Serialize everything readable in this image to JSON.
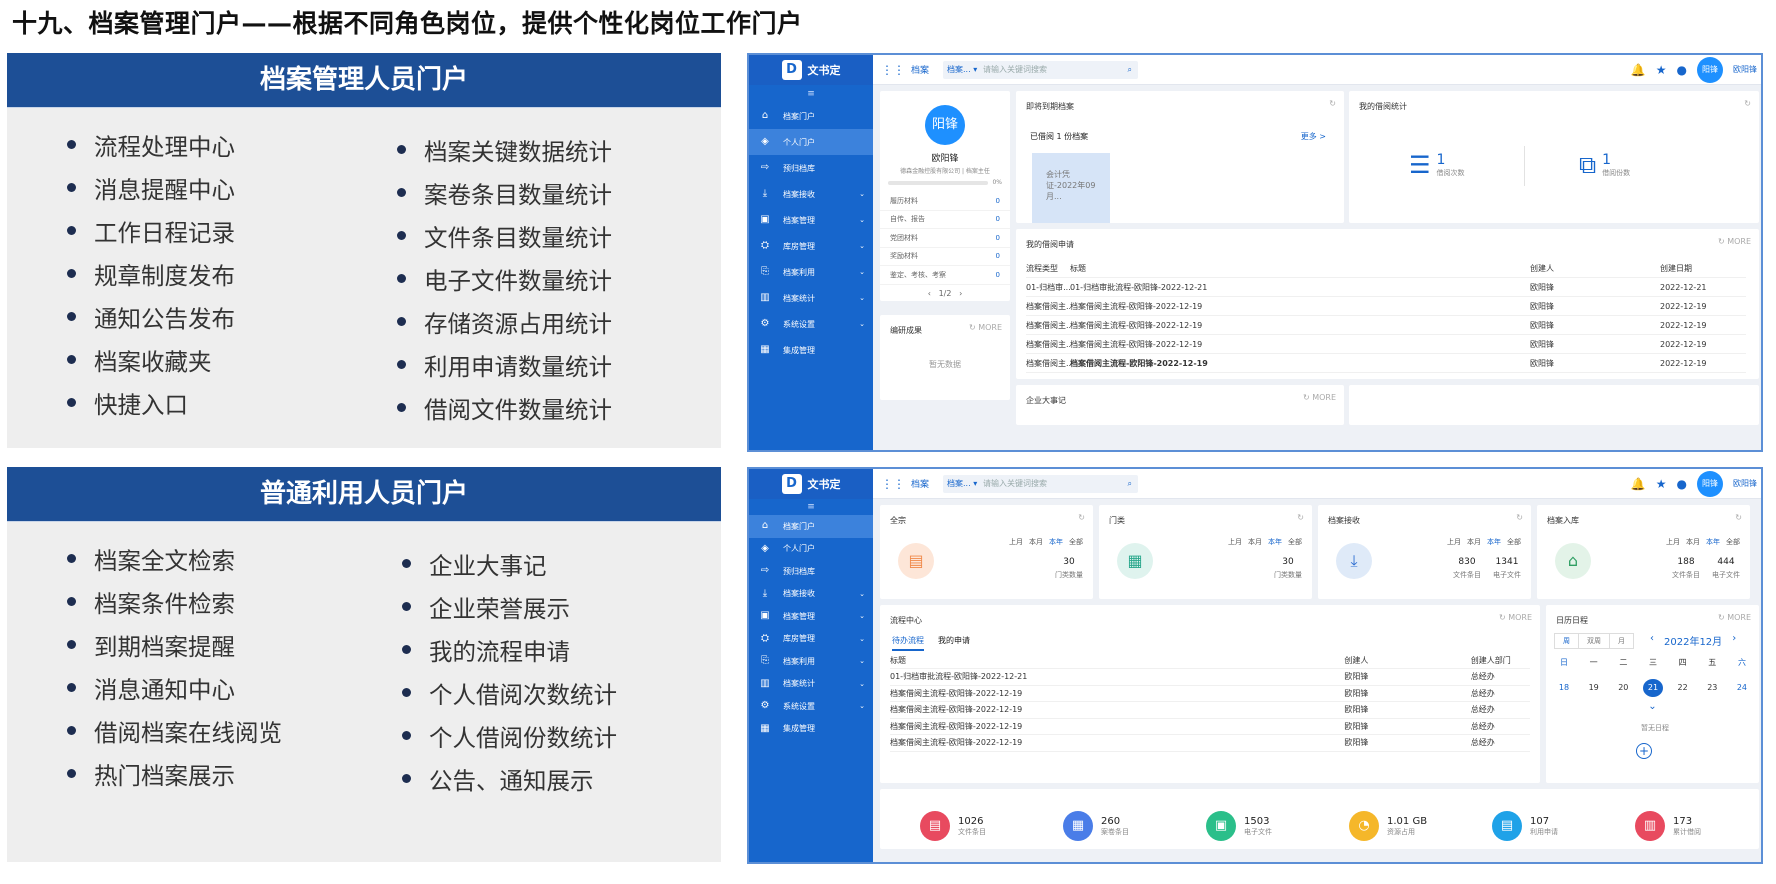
{
  "title": "十九、档案管理门户——根据不同角色岗位，提供个性化岗位工作门户",
  "panel1": {
    "heading": "档案管理人员门户",
    "left": [
      "流程处理中心",
      "消息提醒中心",
      "工作日程记录",
      "规章制度发布",
      "通知公告发布",
      "档案收藏夹",
      "快捷入口"
    ],
    "right": [
      "档案关键数据统计",
      "案卷条目数量统计",
      "文件条目数量统计",
      "电子文件数量统计",
      "存储资源占用统计",
      "利用申请数量统计",
      "借阅文件数量统计"
    ]
  },
  "panel2": {
    "heading": "普通利用人员门户",
    "left": [
      "档案全文检索",
      "档案条件检索",
      "到期档案提醒",
      "消息通知中心",
      "借阅档案在线阅览",
      "热门档案展示"
    ],
    "right": [
      "企业大事记",
      "企业荣誉展示",
      "我的流程申请",
      "个人借阅次数统计",
      "个人借阅份数统计",
      "公告、通知展示"
    ]
  },
  "app": {
    "logo": "文书定",
    "module": "档案",
    "search_select": "档案...",
    "search_placeholder": "请输入关键词搜索",
    "avatar": "阳锋",
    "user": "欧阳锋",
    "sidebar": [
      "档案门户",
      "个人门户",
      "预归档库",
      "档案接收",
      "档案管理",
      "库房管理",
      "档案利用",
      "档案统计",
      "系统设置",
      "集成管理"
    ]
  },
  "s1": {
    "profile": {
      "avatar": "阳锋",
      "name": "欧阳锋",
      "org": "德森金融控股有限公司 | 档案主任",
      "progress": "0%",
      "materials": [
        {
          "k": "履历材料",
          "v": "0"
        },
        {
          "k": "自传、报告",
          "v": "0"
        },
        {
          "k": "党团材料",
          "v": "0"
        },
        {
          "k": "奖励材料",
          "v": "0"
        },
        {
          "k": "鉴定、考核、考察",
          "v": "0"
        }
      ],
      "pager": "1/2"
    },
    "expire": {
      "title": "即将到期档案",
      "borrowed": "已借阅 1 份档案",
      "more": "更多 >",
      "doc": "会计凭证-2022年09月..."
    },
    "stats": {
      "title": "我的借阅统计",
      "times": "1",
      "times_label": "借阅次数",
      "copies": "1",
      "copies_label": "借阅份数"
    },
    "research": {
      "title": "编研成果",
      "more": "MORE",
      "empty": "暂无数据"
    },
    "apply": {
      "title": "我的借阅申请",
      "more": "MORE",
      "headers": [
        "流程类型",
        "标题",
        "创建人",
        "创建日期"
      ],
      "rows": [
        [
          "01-归档审...",
          "01-归档审批流程-欧阳锋-2022-12-21",
          "欧阳锋",
          "2022-12-21"
        ],
        [
          "档案借阅主...",
          "档案借阅主流程-欧阳锋-2022-12-19",
          "欧阳锋",
          "2022-12-19"
        ],
        [
          "档案借阅主...",
          "档案借阅主流程-欧阳锋-2022-12-19",
          "欧阳锋",
          "2022-12-19"
        ],
        [
          "档案借阅主...",
          "档案借阅主流程-欧阳锋-2022-12-19",
          "欧阳锋",
          "2022-12-19"
        ],
        [
          "档案借阅主...",
          "档案借阅主流程-欧阳锋-2022-12-19",
          "欧阳锋",
          "2022-12-19"
        ]
      ]
    },
    "events": {
      "title": "企业大事记",
      "more": "MORE"
    }
  },
  "s2": {
    "cards": [
      {
        "title": "全宗",
        "tabs": [
          "上月",
          "本月",
          "本年",
          "全部"
        ],
        "v1": "30",
        "l1": "门类数量"
      },
      {
        "title": "门类",
        "tabs": [
          "上月",
          "本月",
          "本年",
          "全部"
        ],
        "v1": "30",
        "l1": "门类数量"
      },
      {
        "title": "档案接收",
        "tabs": [
          "上月",
          "本月",
          "本年",
          "全部"
        ],
        "v1": "830",
        "l1": "文件条目",
        "v2": "1341",
        "l2": "电子文件"
      },
      {
        "title": "档案入库",
        "tabs": [
          "上月",
          "本月",
          "本年",
          "全部"
        ],
        "v1": "188",
        "l1": "文件条目",
        "v2": "444",
        "l2": "电子文件"
      }
    ],
    "flow": {
      "title": "流程中心",
      "more": "MORE",
      "tabs": [
        "待办流程",
        "我的申请"
      ],
      "headers": [
        "标题",
        "创建人",
        "创建人部门"
      ],
      "rows": [
        [
          "01-归档审批流程-欧阳锋-2022-12-21",
          "欧阳锋",
          "总经办"
        ],
        [
          "档案借阅主流程-欧阳锋-2022-12-19",
          "欧阳锋",
          "总经办"
        ],
        [
          "档案借阅主流程-欧阳锋-2022-12-19",
          "欧阳锋",
          "总经办"
        ],
        [
          "档案借阅主流程-欧阳锋-2022-12-19",
          "欧阳锋",
          "总经办"
        ],
        [
          "档案借阅主流程-欧阳锋-2022-12-19",
          "欧阳锋",
          "总经办"
        ]
      ]
    },
    "cal": {
      "title": "日历日程",
      "more": "MORE",
      "modes": [
        "周",
        "双周",
        "月"
      ],
      "month": "2022年12月",
      "week": [
        "日",
        "一",
        "二",
        "三",
        "四",
        "五",
        "六"
      ],
      "days": [
        "18",
        "19",
        "20",
        "21",
        "22",
        "23",
        "24"
      ],
      "empty": "暂无日程"
    },
    "bottom": [
      {
        "v": "1026",
        "l": "文件条目",
        "c": "#e84a5f"
      },
      {
        "v": "260",
        "l": "案卷条目",
        "c": "#4a7de8"
      },
      {
        "v": "1503",
        "l": "电子文件",
        "c": "#2bbf8a"
      },
      {
        "v": "1.01 GB",
        "l": "资源占用",
        "c": "#f5b72a"
      },
      {
        "v": "107",
        "l": "利用申请",
        "c": "#1fa2e8"
      },
      {
        "v": "173",
        "l": "累计借阅",
        "c": "#e84a5f"
      }
    ]
  }
}
